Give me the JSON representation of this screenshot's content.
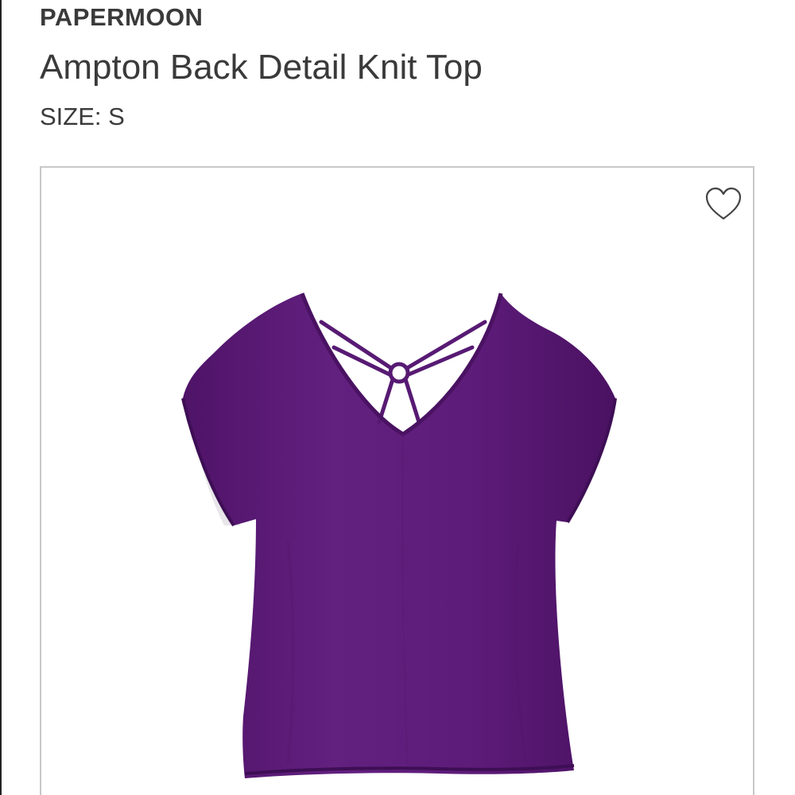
{
  "product": {
    "brand": "PAPERMOON",
    "title": "Ampton Back Detail Knit Top",
    "size_text": "SIZE: S"
  },
  "image": {
    "subject": "purple v-neck knit top with strappy back detail",
    "garment_color": "#5e1a7c",
    "garment_shadow": "#4a1262",
    "border_color": "#c8c8c8"
  },
  "icons": {
    "favorite": "heart-icon"
  }
}
